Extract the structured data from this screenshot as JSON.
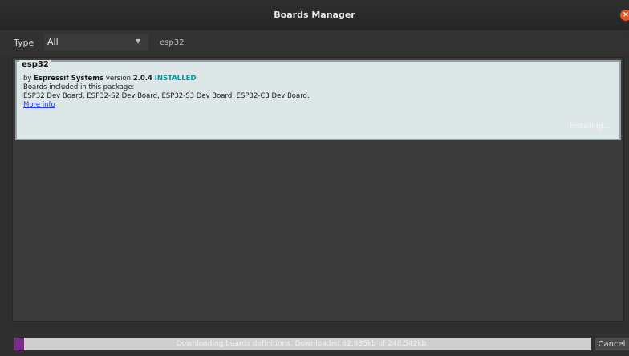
{
  "window": {
    "title": "Boards Manager",
    "close_glyph": "×"
  },
  "filter": {
    "type_label": "Type",
    "type_value": "All",
    "type_arrow": "▼",
    "search_value": "esp32"
  },
  "package": {
    "name": "esp32",
    "by_prefix": "by ",
    "author": "Espressif Systems",
    "version_prefix": " version ",
    "version": "2.0.4",
    "status": "INSTALLED",
    "boards_heading": "Boards included in this package:",
    "boards": "ESP32 Dev Board, ESP32-S2 Dev Board, ESP32-S3 Dev Board, ESP32-C3 Dev Board.",
    "more_info": "More info",
    "progress_label": "Installing..."
  },
  "status": {
    "progress_text": "Downloading boards definitions. Downloaded 62,985kb of 248,542kb.",
    "progress_fraction": 0.018,
    "cancel_label": "Cancel"
  },
  "colors": {
    "accent_installed": "#00979c",
    "progress_fill": "#7a2b8c",
    "close_button": "#e95420"
  }
}
